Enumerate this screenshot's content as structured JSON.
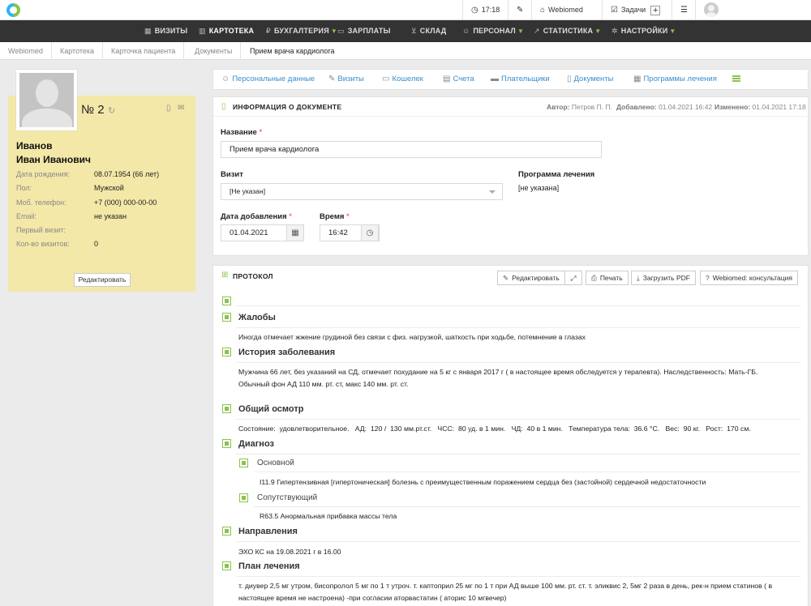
{
  "topbar": {
    "time": "17:18",
    "org": "Webiomed",
    "tasks": "Задачи",
    "plus": "+"
  },
  "nav": {
    "items": [
      {
        "label": "ВИЗИТЫ",
        "icon": "calendar-icon"
      },
      {
        "label": "КАРТОТЕКА",
        "icon": "book-icon"
      },
      {
        "label": "БУХГАЛТЕРИЯ",
        "icon": "ruble-icon"
      },
      {
        "label": "ЗАРПЛАТЫ",
        "icon": "money-icon"
      },
      {
        "label": "СКЛАД",
        "icon": "cart-icon"
      },
      {
        "label": "ПЕРСОНАЛ",
        "icon": "user-icon"
      },
      {
        "label": "СТАТИСТИКА",
        "icon": "chart-icon"
      },
      {
        "label": "НАСТРОЙКИ",
        "icon": "gear-icon"
      }
    ],
    "accent": "#8bc34a"
  },
  "breadcrumb": [
    "Webiomed",
    "Картотека",
    "Карточка пациента",
    "Документы",
    "Прием врача кардиолога"
  ],
  "patient": {
    "number": "№ 2",
    "last_name": "Иванов",
    "first_name": "Иван Иванович",
    "fields": [
      {
        "label": "Дата рождения:",
        "value": "08.07.1954 (66 лет)"
      },
      {
        "label": "Пол:",
        "value": "Мужской"
      },
      {
        "label": "Моб. телефон:",
        "value": "+7 (000) 000-00-00"
      },
      {
        "label": "Email:",
        "value": "не указан"
      },
      {
        "label": "Первый визит:",
        "value": ""
      },
      {
        "label": "Кол-во визитов:",
        "value": "0"
      }
    ],
    "edit_label": "Редактировать",
    "card_color": "#f3e8a8"
  },
  "tabs": [
    "Персональные данные",
    "Визиты",
    "Кошелек",
    "Счета",
    "Плательщики",
    "Документы",
    "Программы лечения"
  ],
  "doc_info": {
    "title": "ИНФОРМАЦИЯ О ДОКУМЕНТЕ",
    "author_label": "Автор:",
    "author": "Петров П. П.",
    "added_label": "Добавлено:",
    "added": "01.04.2021 16:42",
    "changed_label": "Изменено:",
    "changed": "01.04.2021 17:18",
    "name_label": "Название",
    "name_value": "Прием врача кардиолога",
    "visit_label": "Визит",
    "visit_value": "[Не указан]",
    "program_label": "Программа лечения",
    "program_value": "[не указана]",
    "date_label": "Дата добавления",
    "date_value": "01.04.2021",
    "time_label": "Время",
    "time_value": "16:42",
    "required_mark": "*"
  },
  "protocol": {
    "title": "ПРОТОКОЛ",
    "buttons": {
      "edit": "Редактировать",
      "print": "Печать",
      "pdf": "Загрузить PDF",
      "consult": "Webiomed: консультация"
    },
    "sections": {
      "complaints": {
        "title": "Жалобы",
        "text": "Иногда отмечает жжение грудиной без связи с физ. нагрузкой, шаткость при ходьбе,  потемнение в глазах"
      },
      "history": {
        "title": "История заболевания",
        "text1": "Мужчина 66 лет, без указаний на СД, отмечает похудание на 5 кг с января 2017 г ( в настоящее время обследуется у терапевта). Наследственность: Мать-ГБ.",
        "text2": "Обычный фон АД 110 мм. рт. ст, макс 140 мм. рт. ст."
      },
      "exam": {
        "title": "Общий осмотр",
        "text": "Состояние:  удовлетворительное.   АД:  120 /  130 мм.рт.ст.   ЧСС:  80 уд. в 1 мин.   ЧД:  40 в 1 мин.   Температура тела:  36.6 °С.   Вес:  90 кг.   Рост:  170 см."
      },
      "diagnosis": {
        "title": "Диагноз",
        "main_title": "Основной",
        "main_text": "I11.9 Гипертензивная [гипертоническая] болезнь с преимущественным поражением сердца без (застойной) сердечной недостаточности",
        "concomitant_title": "Сопутствующий",
        "concomitant_text": "R63.5 Анормальная прибавка массы тела"
      },
      "referrals": {
        "title": "Направления",
        "text": "ЭХО КС на 19.08.2021 г в 16.00"
      },
      "plan": {
        "title": "План лечения",
        "text1": "т. диувер 2,5 мг утром, бисопролол 5 мг по 1 т утроч. т. каптоприл 25 мг по 1 т при АД выше 100 мм. рт. ст. т. эликвис 2, 5мг 2 раза в день, рек-н прием статинов ( в",
        "text2": "настоящее время не настроена) -при согласии аторвастатин ( аторис 10 мгвечер)"
      }
    }
  }
}
